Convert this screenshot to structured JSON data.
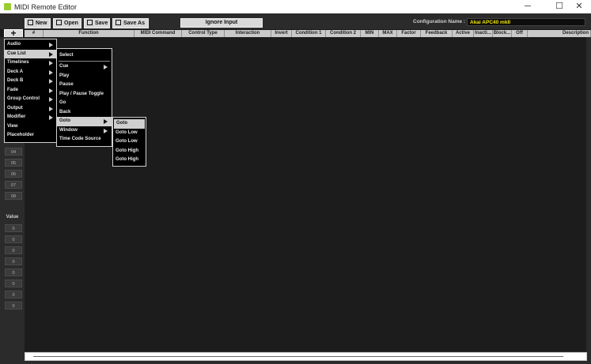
{
  "window": {
    "title": "MIDI Remote Editor",
    "minimize": "─",
    "maximize": "☐",
    "close": "✕"
  },
  "toolbar": {
    "new_label": "New",
    "open_label": "Open",
    "save_label": "Save",
    "saveas_label": "Save As",
    "ignore_input_label": "Ignore Input",
    "config_name_label": "Configuration Name :",
    "config_name_value": "Akai APC40 mkII"
  },
  "add_button": {
    "label": "+"
  },
  "columns": [
    "#",
    "Function",
    "MIDI Command",
    "Control Type",
    "Interaction",
    "Invert",
    "Condition 1",
    "Condition 2",
    "MIN",
    "MAX",
    "Factor",
    "Feedback",
    "Active",
    "Inacti...",
    "Block...",
    "Off",
    "Description"
  ],
  "row_buttons": [
    "04",
    "05",
    "06",
    "07",
    "08"
  ],
  "value_section": {
    "label": "Value",
    "values": [
      "0",
      "0",
      "0",
      "0",
      "0",
      "0",
      "0",
      "0"
    ]
  },
  "menu_main": [
    "Audio",
    "Cue List",
    "Timelines",
    "Deck A",
    "Deck B",
    "Fade",
    "Group Control",
    "Output",
    "Modifier",
    "View",
    "Placeholder"
  ],
  "menu_cuelist": [
    "Select",
    "Cue",
    "Play",
    "Pause",
    "Play / Pause Toggle",
    "Go",
    "Back",
    "Goto",
    "Window",
    "Time Code Source"
  ],
  "menu_goto": [
    "Goto",
    "Goto Low",
    "Goto Low",
    "Goto High",
    "Goto High"
  ],
  "colors": {
    "config_value": "#f2e600",
    "highlight": "#cfcfcf",
    "background": "#1a1a1a"
  }
}
